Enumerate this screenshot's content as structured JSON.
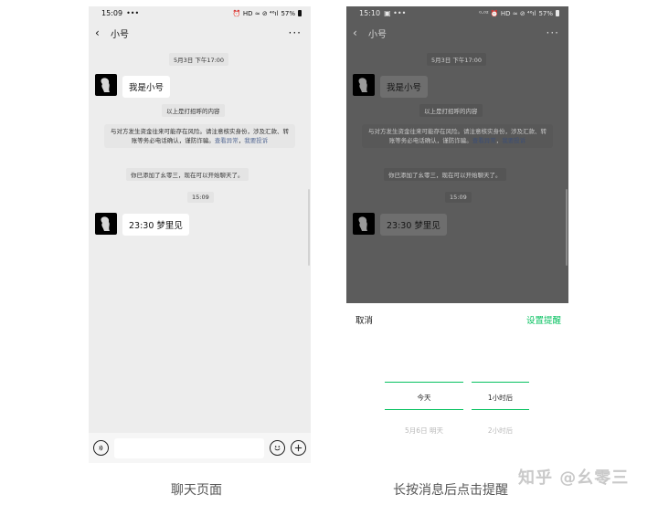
{
  "left_phone": {
    "status": {
      "time": "15:09",
      "indicators": "•••",
      "right_icons": "⏰ HD ≈ ⊘ ⁴⁶ıl",
      "battery": "57%"
    },
    "nav": {
      "title": "小号",
      "back_icon": "‹",
      "more_icon": "···"
    },
    "date_stamp": "5月3日 下午17:00",
    "msg1": "我是小号",
    "greeting_notice": "以上是打招呼的内容",
    "warning_text": "与对方发生资金往来可能存在风险。请注意核实身份，涉及汇款、转账等务必电话确认，谨防诈骗。",
    "warning_link1": "查看异常",
    "warning_link2": "我要投诉",
    "added_notice": "你已添加了幺零三，现在可以开始聊天了。",
    "time_stamp2": "15:09",
    "msg2": "23:30 梦里见",
    "input": {
      "voice_icon": "voice-icon",
      "emoji_icon": "emoji-icon",
      "plus_icon": "plus-icon"
    }
  },
  "right_phone": {
    "status": {
      "time": "15:10",
      "indicators": "▣ •••",
      "right_icons": "⁰·⁰² ⏰ HD ≈ ⊘ ⁴⁶ıl",
      "battery": "57%"
    },
    "nav": {
      "title": "小号",
      "back_icon": "‹",
      "more_icon": "···"
    },
    "date_stamp": "5月3日 下午17:00",
    "msg1": "我是小号",
    "greeting_notice": "以上是打招呼的内容",
    "warning_text": "与对方发生资金往来可能存在风险。请注意核实身份，涉及汇款、转账等务必电话确认，谨防诈骗。",
    "warning_link1": "查看异常",
    "warning_link2": "我要投诉",
    "added_notice": "你已添加了幺零三，现在可以开始聊天了。",
    "time_stamp2": "15:09",
    "msg2": "23:30 梦里见",
    "sheet": {
      "cancel": "取消",
      "confirm": "设置提醒",
      "day_selected": "今天",
      "time_selected": "1小时后",
      "day_next": "5月6日 明天",
      "time_next": "2小时后"
    }
  },
  "captions": {
    "left": "聊天页面",
    "right": "长按消息后点击提醒"
  },
  "watermark": "知乎 @幺零三",
  "colors": {
    "accent_green": "#07c160",
    "link_blue": "#576b95",
    "chat_bg": "#ededed",
    "dim_bg": "#5c5c5c"
  }
}
